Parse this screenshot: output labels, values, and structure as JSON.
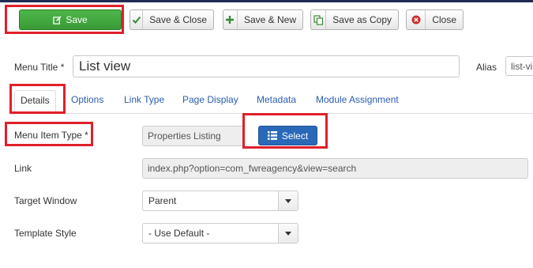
{
  "toolbar": {
    "save_label": "Save",
    "save_close_label": "Save & Close",
    "save_new_label": "Save & New",
    "save_copy_label": "Save as Copy",
    "close_label": "Close"
  },
  "form": {
    "menu_title_label": "Menu Title *",
    "menu_title_value": "List view",
    "alias_label": "Alias",
    "alias_value": "list-view"
  },
  "tabs": [
    {
      "label": "Details",
      "active": true
    },
    {
      "label": "Options"
    },
    {
      "label": "Link Type"
    },
    {
      "label": "Page Display"
    },
    {
      "label": "Metadata"
    },
    {
      "label": "Module Assignment"
    }
  ],
  "details": {
    "menu_item_type_label": "Menu Item Type *",
    "menu_item_type_value": "Properties Listing",
    "select_label": "Select",
    "link_label": "Link",
    "link_value": "index.php?option=com_fwreagency&view=search",
    "target_window_label": "Target Window",
    "target_window_value": "Parent",
    "template_style_label": "Template Style",
    "template_style_value": "- Use Default -"
  },
  "colors": {
    "save_green": "#3a9a36",
    "select_blue": "#2a69b8",
    "highlight_red": "#e0202a",
    "link_blue": "#2a5db0"
  }
}
